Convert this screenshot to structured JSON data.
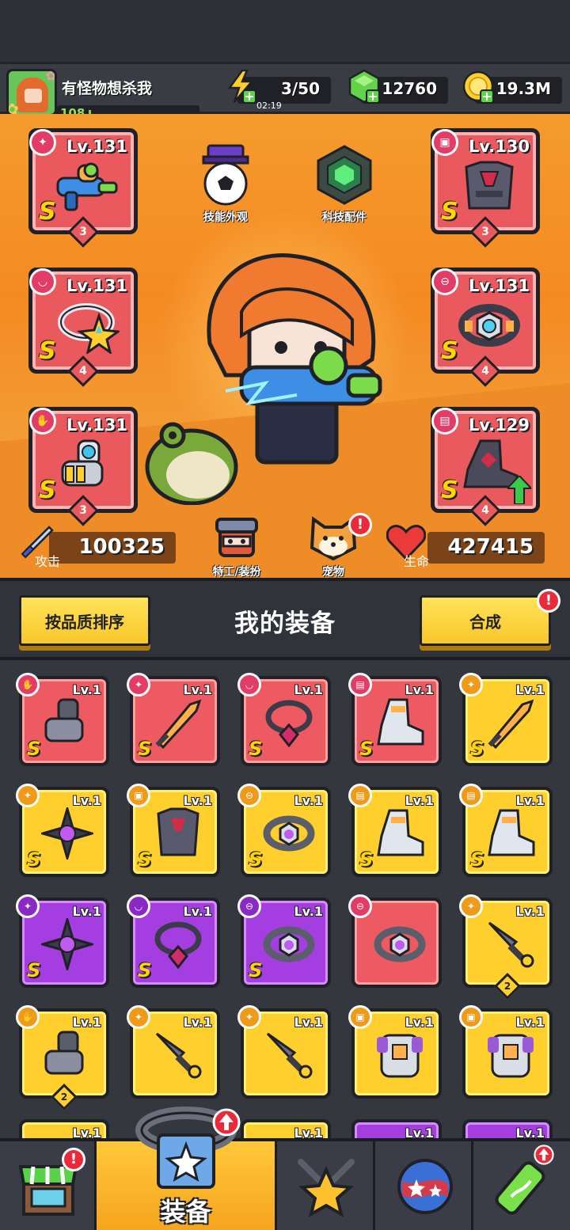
{
  "player": {
    "name": "有怪物想杀我",
    "level": "108"
  },
  "resources": {
    "energy": "3/50",
    "energy_timer": "02:19",
    "gems": "12760",
    "coins": "19.3M"
  },
  "equipped": {
    "left": [
      {
        "level": "Lv.131",
        "grade": "S",
        "stars": "3",
        "category": "weapon"
      },
      {
        "level": "Lv.131",
        "grade": "S",
        "stars": "4",
        "category": "necklace"
      },
      {
        "level": "Lv.131",
        "grade": "S",
        "stars": "3",
        "category": "gloves"
      }
    ],
    "right": [
      {
        "level": "Lv.130",
        "grade": "S",
        "stars": "3",
        "category": "armor"
      },
      {
        "level": "Lv.131",
        "grade": "S",
        "stars": "4",
        "category": "belt"
      },
      {
        "level": "Lv.129",
        "grade": "S",
        "stars": "4",
        "category": "boots"
      }
    ]
  },
  "features": {
    "skill_skin": "技能外观",
    "tech_parts": "科技配件",
    "agent": "特工/装扮",
    "pet": "宠物"
  },
  "stats": {
    "attack_label": "攻击",
    "attack": "100325",
    "hp_label": "生命",
    "hp": "427415"
  },
  "sortbar": {
    "sort_button": "按品质排序",
    "title": "我的装备",
    "merge_button": "合成",
    "merge_badge": "!"
  },
  "inventory": [
    {
      "rarity": "red",
      "level": "Lv.1",
      "grade": "S",
      "category": "gloves",
      "item": "gauntlet"
    },
    {
      "rarity": "red",
      "level": "Lv.1",
      "grade": "S",
      "category": "weapon",
      "item": "sword"
    },
    {
      "rarity": "red",
      "level": "Lv.1",
      "grade": "S",
      "category": "necklace",
      "item": "chain"
    },
    {
      "rarity": "red",
      "level": "Lv.1",
      "grade": "S",
      "category": "boots",
      "item": "boot"
    },
    {
      "rarity": "yellow",
      "level": "Lv.1",
      "grade": "S",
      "category": "weapon",
      "item": "sword"
    },
    {
      "rarity": "yellow",
      "level": "Lv.1",
      "grade": "S",
      "category": "weapon",
      "item": "shuriken"
    },
    {
      "rarity": "yellow",
      "level": "Lv.1",
      "grade": "S",
      "category": "armor",
      "item": "armor"
    },
    {
      "rarity": "yellow",
      "level": "Lv.1",
      "grade": "S",
      "category": "belt",
      "item": "belt"
    },
    {
      "rarity": "yellow",
      "level": "Lv.1",
      "grade": "S",
      "category": "boots",
      "item": "boot"
    },
    {
      "rarity": "yellow",
      "level": "Lv.1",
      "grade": "S",
      "category": "boots",
      "item": "boot"
    },
    {
      "rarity": "purple",
      "level": "Lv.1",
      "grade": "S",
      "category": "weapon",
      "item": "shuriken"
    },
    {
      "rarity": "purple",
      "level": "Lv.1",
      "grade": "S",
      "category": "necklace",
      "item": "chain"
    },
    {
      "rarity": "purple",
      "level": "Lv.1",
      "grade": "S",
      "category": "belt",
      "item": "belt"
    },
    {
      "rarity": "red",
      "level": "",
      "grade": "",
      "category": "belt",
      "item": "belt"
    },
    {
      "rarity": "yellow",
      "level": "Lv.1",
      "grade": "",
      "category": "weapon",
      "item": "kunai",
      "stars": "2"
    },
    {
      "rarity": "yellow",
      "level": "Lv.1",
      "grade": "",
      "category": "gloves",
      "item": "gauntlet",
      "stars": "2"
    },
    {
      "rarity": "yellow",
      "level": "Lv.1",
      "grade": "",
      "category": "weapon",
      "item": "kunai"
    },
    {
      "rarity": "yellow",
      "level": "Lv.1",
      "grade": "",
      "category": "weapon",
      "item": "kunai"
    },
    {
      "rarity": "yellow",
      "level": "Lv.1",
      "grade": "",
      "category": "armor",
      "item": "vest"
    },
    {
      "rarity": "yellow",
      "level": "Lv.1",
      "grade": "",
      "category": "armor",
      "item": "vest"
    }
  ],
  "partial_row_levels": [
    "Lv.1",
    "Lv.1",
    "Lv.1",
    "Lv.1"
  ],
  "nav": {
    "shop_badge": "!",
    "equipment_label": "装备"
  },
  "colors": {
    "red_rarity": "#ee5a61",
    "yellow_rarity": "#ffcf2e",
    "purple_rarity": "#a43ee0",
    "arena_orange": "#f48a22"
  }
}
